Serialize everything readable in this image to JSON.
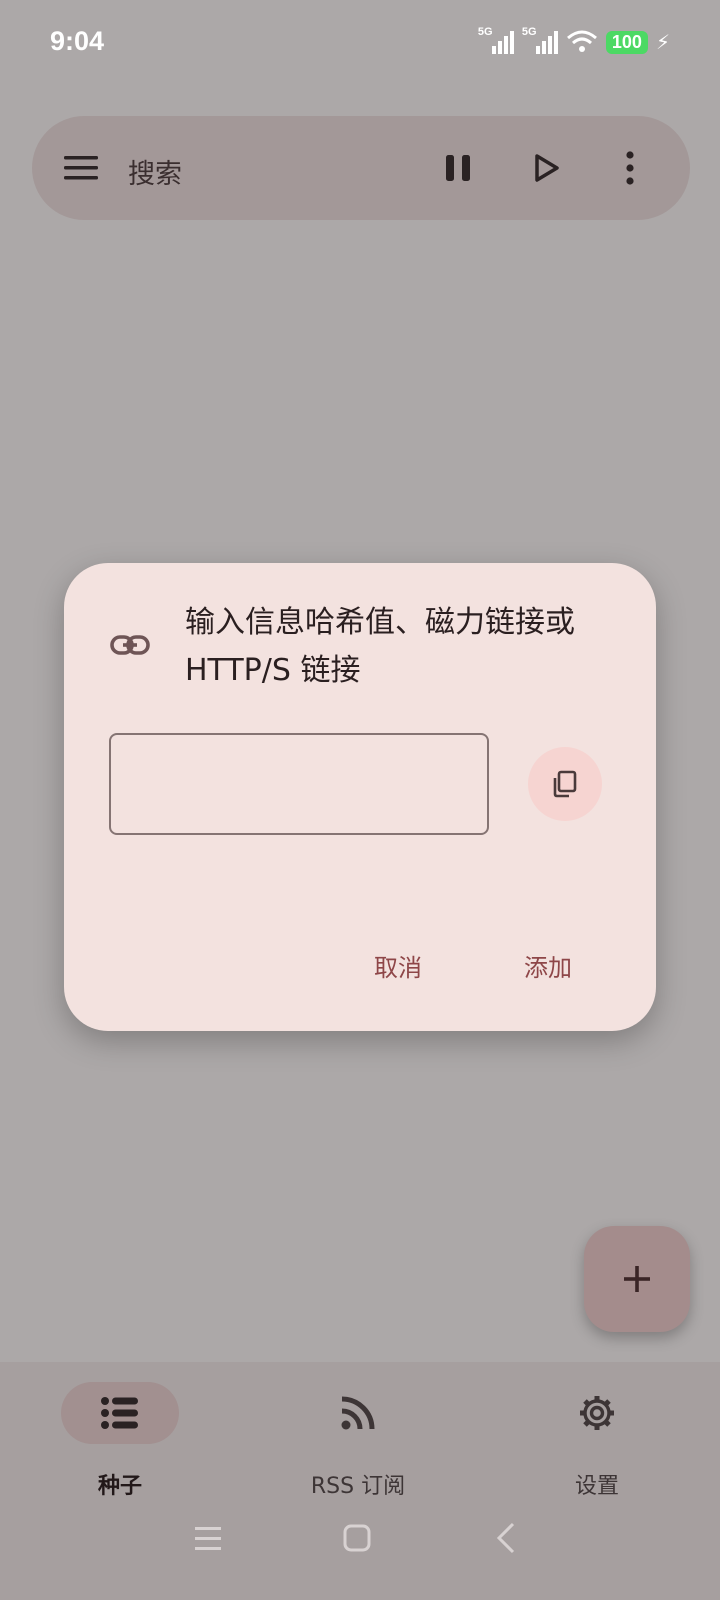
{
  "status_bar": {
    "time": "9:04",
    "sim1": "5G",
    "sim2": "5G",
    "battery": "100"
  },
  "search_bar": {
    "placeholder": "搜索",
    "icons": [
      "menu-icon",
      "pause-icon",
      "play-icon",
      "more-vert-icon"
    ]
  },
  "dialog": {
    "title": "输入信息哈希值、磁力链接或 HTTP/S 链接",
    "input_value": "",
    "cancel_label": "取消",
    "add_label": "添加",
    "icons": [
      "link-icon",
      "paste-icon"
    ]
  },
  "fab": {
    "icon": "plus-icon"
  },
  "bottom_nav": {
    "items": [
      {
        "label": "种子",
        "icon": "list-icon",
        "active": true
      },
      {
        "label": "RSS 订阅",
        "icon": "rss-icon",
        "active": false
      },
      {
        "label": "设置",
        "icon": "gear-icon",
        "active": false
      }
    ]
  },
  "colors": {
    "scrim": "#aca8a8",
    "dialog_bg": "#f3e2df",
    "accent": "#8e4648",
    "battery": "#4cd964"
  }
}
